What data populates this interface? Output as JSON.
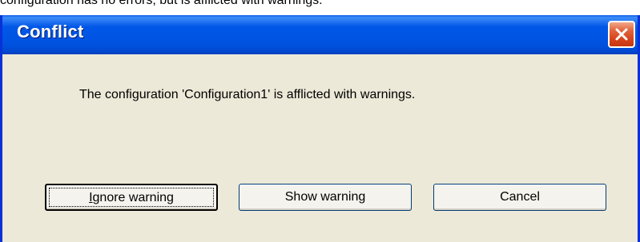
{
  "background_text": "configuration has no errors, but is afflicted with warnings.",
  "dialog": {
    "title": "Conflict",
    "message": "The configuration 'Configuration1' is afflicted with warnings.",
    "buttons": {
      "ignore_prefix": "I",
      "ignore_rest": "gnore warning",
      "show": "Show warning",
      "cancel": "Cancel"
    },
    "close_icon": "close-icon"
  },
  "colors": {
    "titlebar": "#0054e3",
    "client": "#ece9d8",
    "close_button": "#d8431b"
  }
}
